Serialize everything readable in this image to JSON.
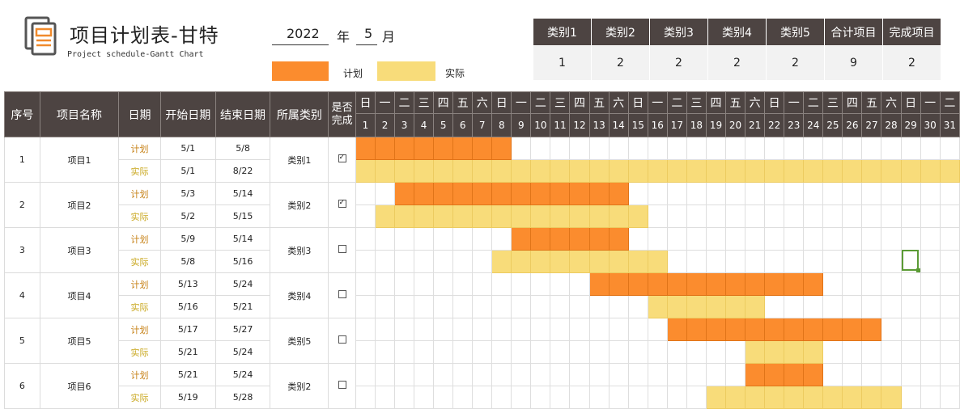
{
  "header": {
    "title": "项目计划表-甘特",
    "subtitle": "Project schedule-Gantt Chart",
    "year": "2022",
    "year_label": "年",
    "month": "5",
    "month_label": "月",
    "legend_plan": "计划",
    "legend_actual": "实际"
  },
  "colors": {
    "plan": "#fb8c2e",
    "actual": "#f8dc7a",
    "header_bg": "#4d4442",
    "plan_text": "#c8841b",
    "actual_text": "#c8a61b"
  },
  "summary": {
    "headers": [
      "类别1",
      "类别2",
      "类别3",
      "类别4",
      "类别5",
      "合计项目",
      "完成项目"
    ],
    "values": [
      "1",
      "2",
      "2",
      "2",
      "2",
      "9",
      "2"
    ]
  },
  "table": {
    "columns": {
      "seq": "序号",
      "name": "项目名称",
      "kind": "日期",
      "start": "开始日期",
      "end": "结束日期",
      "category": "所属类别",
      "done": "是否完成"
    },
    "weekdays": [
      "日",
      "一",
      "二",
      "三",
      "四",
      "五",
      "六",
      "日",
      "一",
      "二",
      "三",
      "四",
      "五",
      "六",
      "日",
      "一",
      "二",
      "三",
      "四",
      "五",
      "六",
      "日",
      "一",
      "二",
      "三",
      "四",
      "五",
      "六",
      "日",
      "一",
      "二"
    ],
    "days": [
      "1",
      "2",
      "3",
      "4",
      "5",
      "6",
      "7",
      "8",
      "9",
      "10",
      "11",
      "12",
      "13",
      "14",
      "15",
      "16",
      "17",
      "18",
      "19",
      "20",
      "21",
      "22",
      "23",
      "24",
      "25",
      "26",
      "27",
      "28",
      "29",
      "30",
      "31"
    ],
    "projects": [
      {
        "seq": "1",
        "name": "项目1",
        "category": "类别1",
        "done": true,
        "plan": {
          "label": "计划",
          "start": "5/1",
          "end": "5/8",
          "from": 1,
          "to": 8
        },
        "actual": {
          "label": "实际",
          "start": "5/1",
          "end": "8/22",
          "from": 1,
          "to": 31
        }
      },
      {
        "seq": "2",
        "name": "项目2",
        "category": "类别2",
        "done": true,
        "plan": {
          "label": "计划",
          "start": "5/3",
          "end": "5/14",
          "from": 3,
          "to": 14
        },
        "actual": {
          "label": "实际",
          "start": "5/2",
          "end": "5/15",
          "from": 2,
          "to": 15
        }
      },
      {
        "seq": "3",
        "name": "项目3",
        "category": "类别3",
        "done": false,
        "plan": {
          "label": "计划",
          "start": "5/9",
          "end": "5/14",
          "from": 9,
          "to": 14
        },
        "actual": {
          "label": "实际",
          "start": "5/8",
          "end": "5/16",
          "from": 8,
          "to": 16
        }
      },
      {
        "seq": "4",
        "name": "项目4",
        "category": "类别4",
        "done": false,
        "plan": {
          "label": "计划",
          "start": "5/13",
          "end": "5/24",
          "from": 13,
          "to": 24
        },
        "actual": {
          "label": "实际",
          "start": "5/16",
          "end": "5/21",
          "from": 16,
          "to": 21
        }
      },
      {
        "seq": "5",
        "name": "项目5",
        "category": "类别5",
        "done": false,
        "plan": {
          "label": "计划",
          "start": "5/17",
          "end": "5/27",
          "from": 17,
          "to": 27
        },
        "actual": {
          "label": "实际",
          "start": "5/21",
          "end": "5/24",
          "from": 21,
          "to": 24
        }
      },
      {
        "seq": "6",
        "name": "项目6",
        "category": "类别2",
        "done": false,
        "plan": {
          "label": "计划",
          "start": "5/21",
          "end": "5/24",
          "from": 21,
          "to": 24
        },
        "actual": {
          "label": "实际",
          "start": "5/19",
          "end": "5/28",
          "from": 19,
          "to": 28
        }
      }
    ]
  }
}
